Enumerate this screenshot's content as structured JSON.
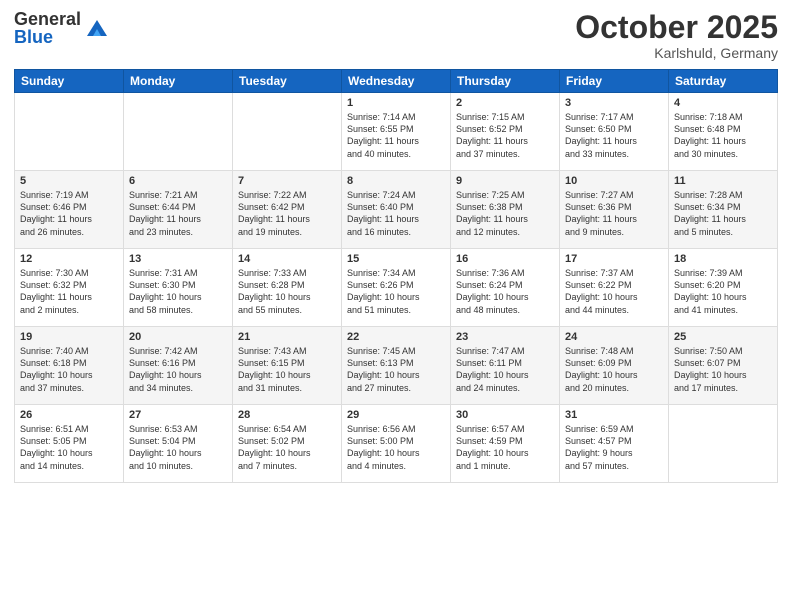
{
  "header": {
    "logo": {
      "general": "General",
      "blue": "Blue"
    },
    "month": "October 2025",
    "location": "Karlshuld, Germany"
  },
  "days_of_week": [
    "Sunday",
    "Monday",
    "Tuesday",
    "Wednesday",
    "Thursday",
    "Friday",
    "Saturday"
  ],
  "weeks": [
    [
      {
        "day": "",
        "info": ""
      },
      {
        "day": "",
        "info": ""
      },
      {
        "day": "",
        "info": ""
      },
      {
        "day": "1",
        "info": "Sunrise: 7:14 AM\nSunset: 6:55 PM\nDaylight: 11 hours\nand 40 minutes."
      },
      {
        "day": "2",
        "info": "Sunrise: 7:15 AM\nSunset: 6:52 PM\nDaylight: 11 hours\nand 37 minutes."
      },
      {
        "day": "3",
        "info": "Sunrise: 7:17 AM\nSunset: 6:50 PM\nDaylight: 11 hours\nand 33 minutes."
      },
      {
        "day": "4",
        "info": "Sunrise: 7:18 AM\nSunset: 6:48 PM\nDaylight: 11 hours\nand 30 minutes."
      }
    ],
    [
      {
        "day": "5",
        "info": "Sunrise: 7:19 AM\nSunset: 6:46 PM\nDaylight: 11 hours\nand 26 minutes."
      },
      {
        "day": "6",
        "info": "Sunrise: 7:21 AM\nSunset: 6:44 PM\nDaylight: 11 hours\nand 23 minutes."
      },
      {
        "day": "7",
        "info": "Sunrise: 7:22 AM\nSunset: 6:42 PM\nDaylight: 11 hours\nand 19 minutes."
      },
      {
        "day": "8",
        "info": "Sunrise: 7:24 AM\nSunset: 6:40 PM\nDaylight: 11 hours\nand 16 minutes."
      },
      {
        "day": "9",
        "info": "Sunrise: 7:25 AM\nSunset: 6:38 PM\nDaylight: 11 hours\nand 12 minutes."
      },
      {
        "day": "10",
        "info": "Sunrise: 7:27 AM\nSunset: 6:36 PM\nDaylight: 11 hours\nand 9 minutes."
      },
      {
        "day": "11",
        "info": "Sunrise: 7:28 AM\nSunset: 6:34 PM\nDaylight: 11 hours\nand 5 minutes."
      }
    ],
    [
      {
        "day": "12",
        "info": "Sunrise: 7:30 AM\nSunset: 6:32 PM\nDaylight: 11 hours\nand 2 minutes."
      },
      {
        "day": "13",
        "info": "Sunrise: 7:31 AM\nSunset: 6:30 PM\nDaylight: 10 hours\nand 58 minutes."
      },
      {
        "day": "14",
        "info": "Sunrise: 7:33 AM\nSunset: 6:28 PM\nDaylight: 10 hours\nand 55 minutes."
      },
      {
        "day": "15",
        "info": "Sunrise: 7:34 AM\nSunset: 6:26 PM\nDaylight: 10 hours\nand 51 minutes."
      },
      {
        "day": "16",
        "info": "Sunrise: 7:36 AM\nSunset: 6:24 PM\nDaylight: 10 hours\nand 48 minutes."
      },
      {
        "day": "17",
        "info": "Sunrise: 7:37 AM\nSunset: 6:22 PM\nDaylight: 10 hours\nand 44 minutes."
      },
      {
        "day": "18",
        "info": "Sunrise: 7:39 AM\nSunset: 6:20 PM\nDaylight: 10 hours\nand 41 minutes."
      }
    ],
    [
      {
        "day": "19",
        "info": "Sunrise: 7:40 AM\nSunset: 6:18 PM\nDaylight: 10 hours\nand 37 minutes."
      },
      {
        "day": "20",
        "info": "Sunrise: 7:42 AM\nSunset: 6:16 PM\nDaylight: 10 hours\nand 34 minutes."
      },
      {
        "day": "21",
        "info": "Sunrise: 7:43 AM\nSunset: 6:15 PM\nDaylight: 10 hours\nand 31 minutes."
      },
      {
        "day": "22",
        "info": "Sunrise: 7:45 AM\nSunset: 6:13 PM\nDaylight: 10 hours\nand 27 minutes."
      },
      {
        "day": "23",
        "info": "Sunrise: 7:47 AM\nSunset: 6:11 PM\nDaylight: 10 hours\nand 24 minutes."
      },
      {
        "day": "24",
        "info": "Sunrise: 7:48 AM\nSunset: 6:09 PM\nDaylight: 10 hours\nand 20 minutes."
      },
      {
        "day": "25",
        "info": "Sunrise: 7:50 AM\nSunset: 6:07 PM\nDaylight: 10 hours\nand 17 minutes."
      }
    ],
    [
      {
        "day": "26",
        "info": "Sunrise: 6:51 AM\nSunset: 5:05 PM\nDaylight: 10 hours\nand 14 minutes."
      },
      {
        "day": "27",
        "info": "Sunrise: 6:53 AM\nSunset: 5:04 PM\nDaylight: 10 hours\nand 10 minutes."
      },
      {
        "day": "28",
        "info": "Sunrise: 6:54 AM\nSunset: 5:02 PM\nDaylight: 10 hours\nand 7 minutes."
      },
      {
        "day": "29",
        "info": "Sunrise: 6:56 AM\nSunset: 5:00 PM\nDaylight: 10 hours\nand 4 minutes."
      },
      {
        "day": "30",
        "info": "Sunrise: 6:57 AM\nSunset: 4:59 PM\nDaylight: 10 hours\nand 1 minute."
      },
      {
        "day": "31",
        "info": "Sunrise: 6:59 AM\nSunset: 4:57 PM\nDaylight: 9 hours\nand 57 minutes."
      },
      {
        "day": "",
        "info": ""
      }
    ]
  ]
}
